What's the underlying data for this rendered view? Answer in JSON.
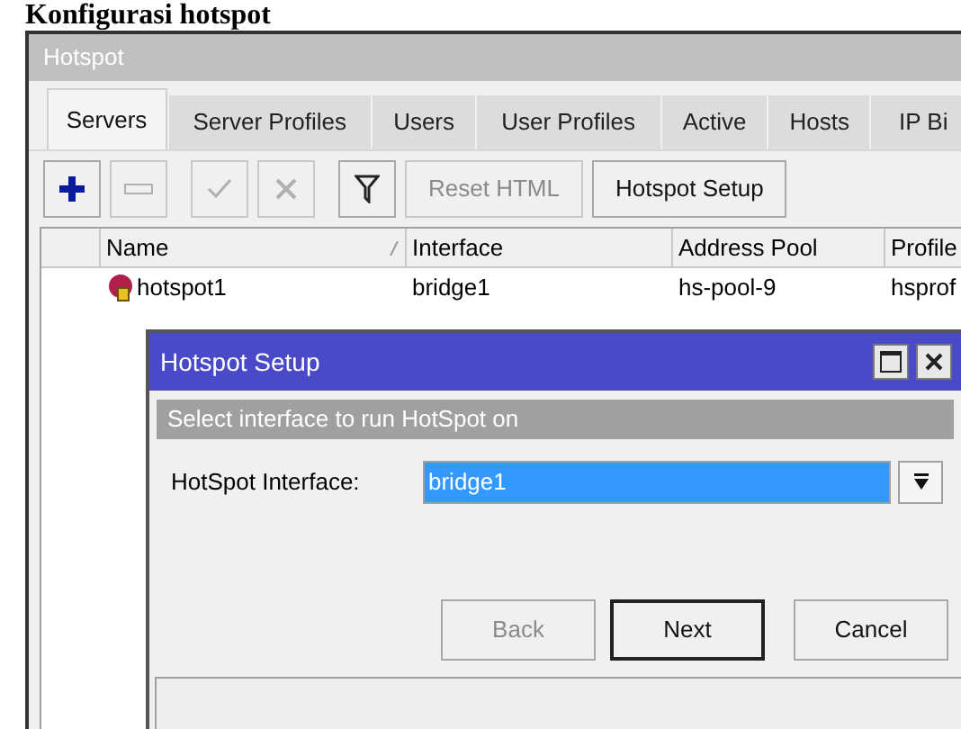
{
  "heading": "Konfigurasi hotspot",
  "window": {
    "title": "Hotspot",
    "tabs": [
      {
        "label": "Servers",
        "selected": true
      },
      {
        "label": "Server Profiles",
        "selected": false
      },
      {
        "label": "Users",
        "selected": false
      },
      {
        "label": "User Profiles",
        "selected": false
      },
      {
        "label": "Active",
        "selected": false
      },
      {
        "label": "Hosts",
        "selected": false
      },
      {
        "label": "IP Bi",
        "selected": false
      }
    ],
    "toolbar": [
      {
        "kind": "add",
        "disabled": false
      },
      {
        "kind": "remove",
        "disabled": true
      },
      {
        "kind": "enable",
        "disabled": true
      },
      {
        "kind": "disable",
        "disabled": true
      },
      {
        "kind": "filter",
        "disabled": false
      },
      {
        "kind": "text",
        "label": "Reset HTML",
        "disabled": true
      },
      {
        "kind": "text",
        "label": "Hotspot Setup",
        "disabled": false
      }
    ],
    "table": {
      "columns": [
        "Name",
        "Interface",
        "Address Pool",
        "Profile"
      ],
      "rows": [
        {
          "cells": [
            "hotspot1",
            "bridge1",
            "hs-pool-9",
            "hsprof"
          ]
        }
      ]
    }
  },
  "dialog": {
    "title": "Hotspot Setup",
    "subtitle": "Select interface to run HotSpot on",
    "field": {
      "label": "HotSpot Interface:",
      "value": "bridge1"
    },
    "buttons": [
      {
        "label": "Back",
        "disabled": true,
        "default": false
      },
      {
        "label": "Next",
        "disabled": false,
        "default": true
      },
      {
        "label": "Cancel",
        "disabled": false,
        "default": false
      }
    ]
  }
}
